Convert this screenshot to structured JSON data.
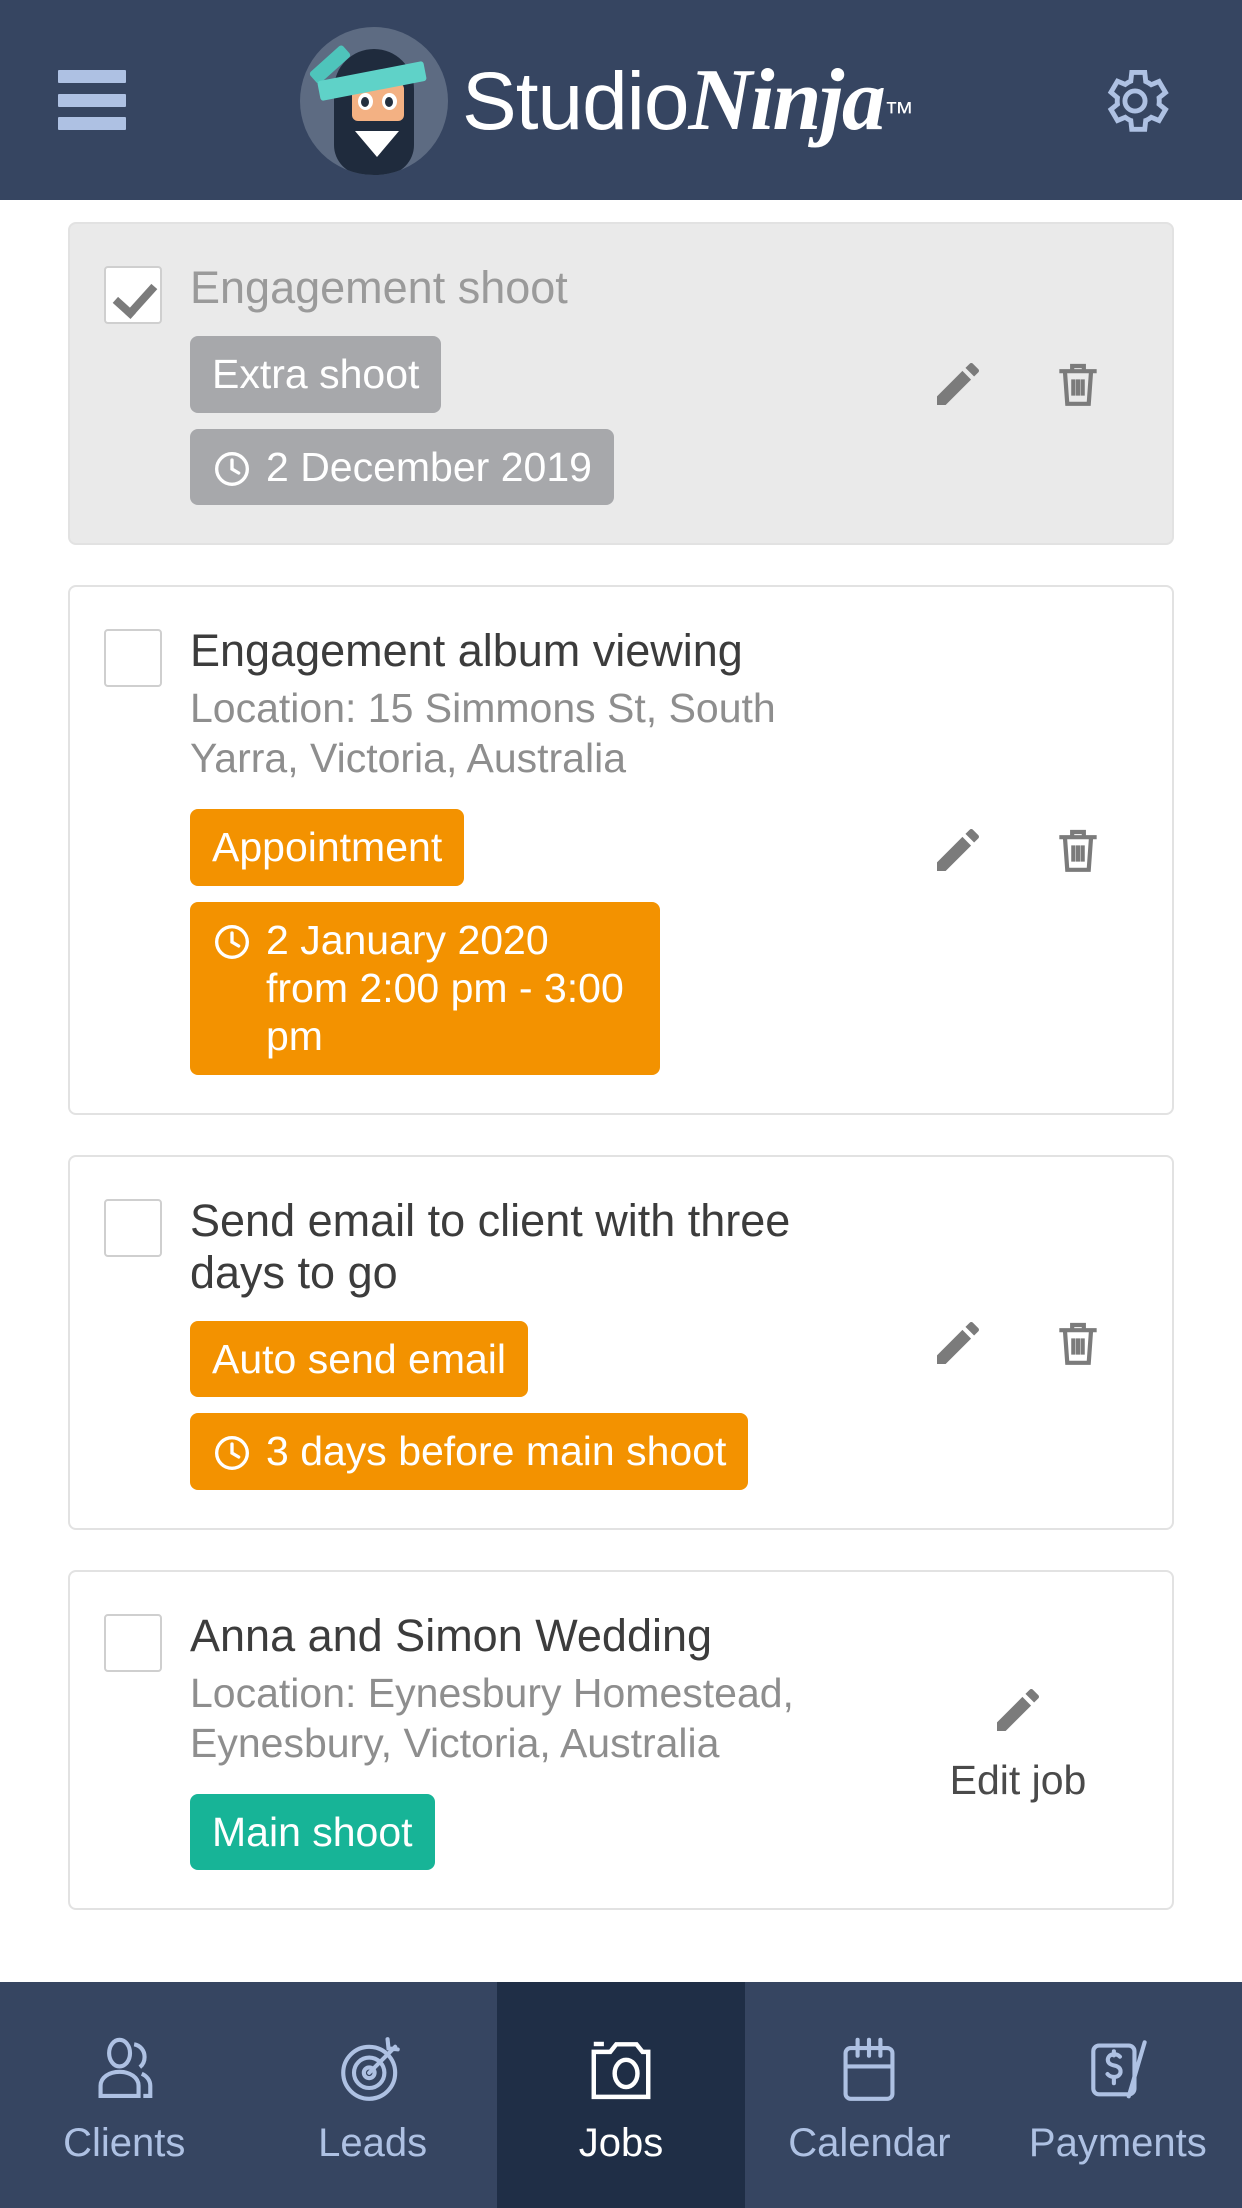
{
  "header": {
    "menu_icon": "hamburger-menu-icon",
    "logo_icon": "ninja-avatar-icon",
    "brand_primary": "Studio",
    "brand_secondary": "Ninja",
    "brand_trademark": "™",
    "settings_icon": "gear-icon"
  },
  "colors": {
    "header_bg": "#364561",
    "nav_bg": "#364561",
    "nav_active_bg": "#1f2e46",
    "nav_text": "#aec1e3",
    "accent_orange": "#f39200",
    "accent_teal": "#17b497",
    "badge_gray": "#a7a8ab",
    "card_done_bg": "#eaeaea"
  },
  "tasks": [
    {
      "checked": true,
      "done": true,
      "title": "Engagement shoot",
      "location": "",
      "badges": [
        {
          "label": "Extra shoot",
          "color": "gray",
          "clock": false
        },
        {
          "label": "2 December 2019",
          "color": "gray",
          "clock": true
        }
      ],
      "actions": {
        "edit_icon": "pencil-icon",
        "delete_icon": "trash-icon",
        "edit_label": ""
      }
    },
    {
      "checked": false,
      "done": false,
      "title": "Engagement album viewing",
      "location": "Location: 15 Simmons St, South Yarra, Victoria, Australia",
      "badges": [
        {
          "label": "Appointment",
          "color": "orange",
          "clock": false
        },
        {
          "label": "2 January 2020 from 2:00 pm - 3:00 pm",
          "color": "orange",
          "clock": true
        }
      ],
      "actions": {
        "edit_icon": "pencil-icon",
        "delete_icon": "trash-icon",
        "edit_label": ""
      }
    },
    {
      "checked": false,
      "done": false,
      "title": "Send email to client with three days to go",
      "location": "",
      "badges": [
        {
          "label": "Auto send email",
          "color": "orange",
          "clock": false
        },
        {
          "label": "3 days before main shoot",
          "color": "orange",
          "clock": true
        }
      ],
      "actions": {
        "edit_icon": "pencil-icon",
        "delete_icon": "trash-icon",
        "edit_label": ""
      }
    },
    {
      "checked": false,
      "done": false,
      "title": "Anna and Simon Wedding",
      "location": "Location: Eynesbury Homestead, Eynesbury, Victoria, Australia",
      "badges": [
        {
          "label": "Main shoot",
          "color": "teal",
          "clock": false
        }
      ],
      "actions": {
        "edit_icon": "pencil-icon",
        "delete_icon": "",
        "edit_label": "Edit job"
      }
    }
  ],
  "bottom_nav": {
    "items": [
      {
        "label": "Clients",
        "icon": "people-icon",
        "active": false
      },
      {
        "label": "Leads",
        "icon": "target-icon",
        "active": false
      },
      {
        "label": "Jobs",
        "icon": "camera-icon",
        "active": true
      },
      {
        "label": "Calendar",
        "icon": "calendar-icon",
        "active": false
      },
      {
        "label": "Payments",
        "icon": "dollar-bill-icon",
        "active": false
      }
    ]
  }
}
